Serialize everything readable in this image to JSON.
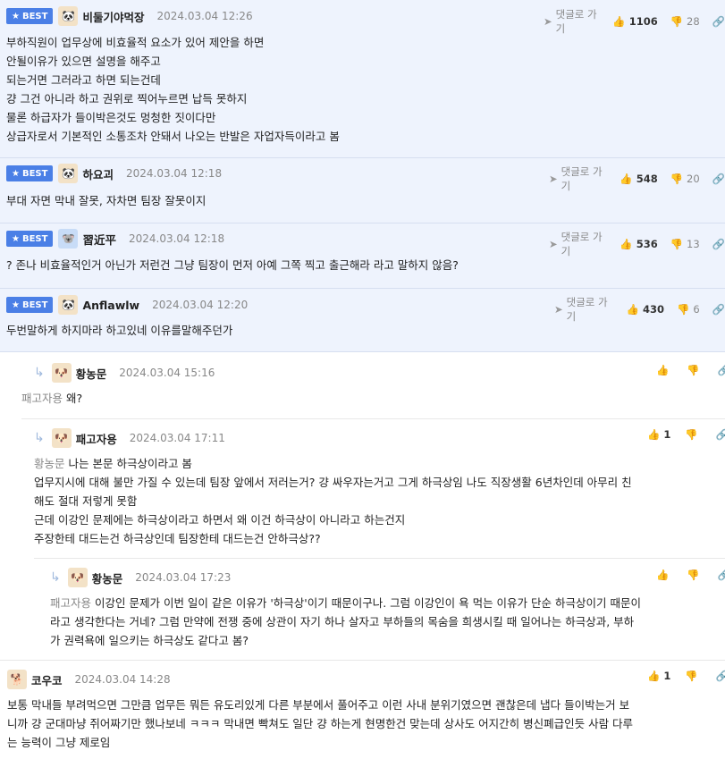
{
  "best_badge_label": "BEST",
  "reply_label": "댓글로 가기",
  "comments": [
    {
      "nick": "비둘기야먹장",
      "date": "2024.03.04 12:26",
      "up": "1106",
      "down": "28",
      "lines": [
        "부하직원이 업무상에 비효율적 요소가 있어 제안을 하면",
        "안될이유가 있으면 설명을 해주고",
        "되는거면 그러라고 하면 되는건데",
        "걍 그건 아니라 하고 권위로 찍어누르면 납득 못하지",
        "물론 하급자가 들이박은것도 멍청한 짓이다만",
        "상급자로서 기본적인 소통조차 안돼서 나오는 반발은 자업자득이라고 봄"
      ]
    },
    {
      "nick": "하요괴",
      "date": "2024.03.04 12:18",
      "up": "548",
      "down": "20",
      "lines": [
        "부대 자면 막내 잘못, 자차면 팀장 잘못이지"
      ]
    },
    {
      "nick": "習近平",
      "date": "2024.03.04 12:18",
      "up": "536",
      "down": "13",
      "lines": [
        "? 존나 비효율적인거 아닌가 저런건 그냥 팀장이 먼저 아예 그쪽 찍고 출근해라 라고 말하지 않음?"
      ]
    },
    {
      "nick": "Anflawlw",
      "date": "2024.03.04 12:20",
      "up": "430",
      "down": "6",
      "lines": [
        "두번말하게 하지마라 하고있네 이유를말해주던가"
      ]
    },
    {
      "nick": "황농문",
      "date": "2024.03.04 15:16",
      "up": "",
      "mention": "패고자용",
      "lines": [
        "왜?"
      ]
    },
    {
      "nick": "패고자용",
      "date": "2024.03.04 17:11",
      "up": "1",
      "mention": "황농문",
      "first": "나는 본문 하극상이라고 봄",
      "lines": [
        "업무지시에 대해 불만 가질 수 있는데 팀장 앞에서 저러는거? 걍 싸우자는거고 그게 하극상임 나도 직장생활 6년차인데 아무리 친",
        "해도 절대 저렇게 못함",
        "근데 이강인 문제에는 하극상이라고 하면서 왜 이건 하극상이 아니라고 하는건지",
        "주장한테 대드는건 하극상인데 팀장한테 대드는건 안하극상??"
      ]
    },
    {
      "nick": "황농문",
      "date": "2024.03.04 17:23",
      "up": "",
      "mention": "패고자용",
      "first": "이강인 문제가 이번 일이 같은 이유가 '하극상'이기 때문이구나. 그럼 이강인이 욕 먹는 이유가 단순 하극상이기 때문이",
      "lines": [
        "라고 생각한다는 거네? 그럼 만약에 전쟁 중에 상관이 자기 하나 살자고 부하들의 목숨을 희생시킬 때 일어나는 하극상과, 부하",
        "가 권력욕에 일으키는 하극상도 같다고 봄?"
      ]
    },
    {
      "nick": "코우코",
      "date": "2024.03.04 14:28",
      "up": "1",
      "lines": [
        "보통 막내들 부려먹으면 그만큼 업무든 뭐든 유도리있게 다른 부분에서 풀어주고 이런 사내 분위기였으면 괜찮은데 냅다 들이박는거 보",
        "니까 걍 군대마냥 쥐어짜기만 했나보네 ㅋㅋㅋ 막내면 빡쳐도 일단 걍 하는게 현명한건 맞는데 상사도 어지간히 병신폐급인듯 사람 다루",
        "는 능력이 그냥 제로임"
      ]
    }
  ]
}
